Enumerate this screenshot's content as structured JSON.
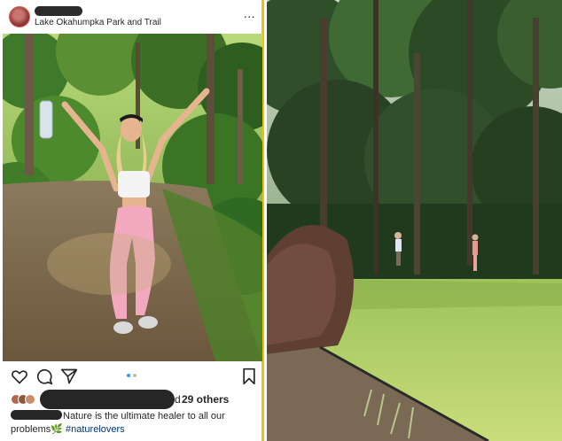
{
  "post": {
    "location": "Lake Okahumpka Park and Trail",
    "more_label": "...",
    "likes_suffix": "29 others",
    "likes_prefix": "d",
    "caption_text": "Nature is the ultimate healer to all our problems",
    "caption_emoji": "🌿",
    "hashtag": "#naturelovers",
    "carousel": {
      "count": 2,
      "active": 1
    }
  },
  "icons": [
    "heart-icon",
    "comment-icon",
    "share-icon",
    "bookmark-icon",
    "more-icon"
  ],
  "colors": {
    "divider": "#f2c200",
    "carousel_active": "#3897f0",
    "hashtag": "#003569"
  }
}
